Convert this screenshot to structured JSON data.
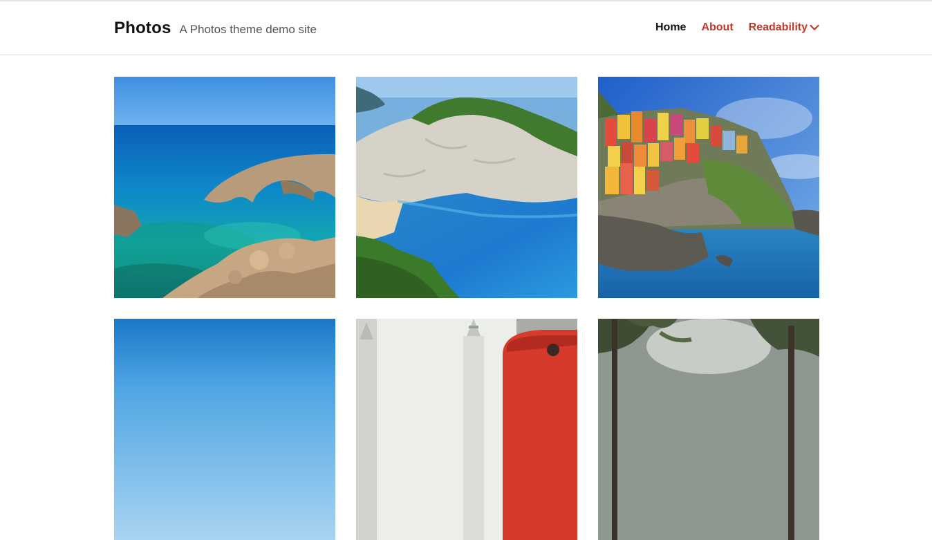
{
  "site": {
    "title": "Photos",
    "description": "A Photos theme demo site"
  },
  "nav": {
    "items": [
      {
        "label": "Home",
        "active": true
      },
      {
        "label": "About",
        "active": false
      },
      {
        "label": "Readability",
        "active": false,
        "has_dropdown": true
      }
    ]
  },
  "colors": {
    "accent": "#c0392b",
    "text": "#111111",
    "muted": "#555555",
    "divider": "#dcdcdc"
  },
  "gallery": {
    "photos": [
      {
        "name": "sea-arch-photo"
      },
      {
        "name": "shipwreck-cove-photo"
      },
      {
        "name": "cliff-village-photo"
      },
      {
        "name": "blue-sky-photo"
      },
      {
        "name": "city-telephone-booth-photo"
      },
      {
        "name": "forest-photo"
      }
    ]
  }
}
